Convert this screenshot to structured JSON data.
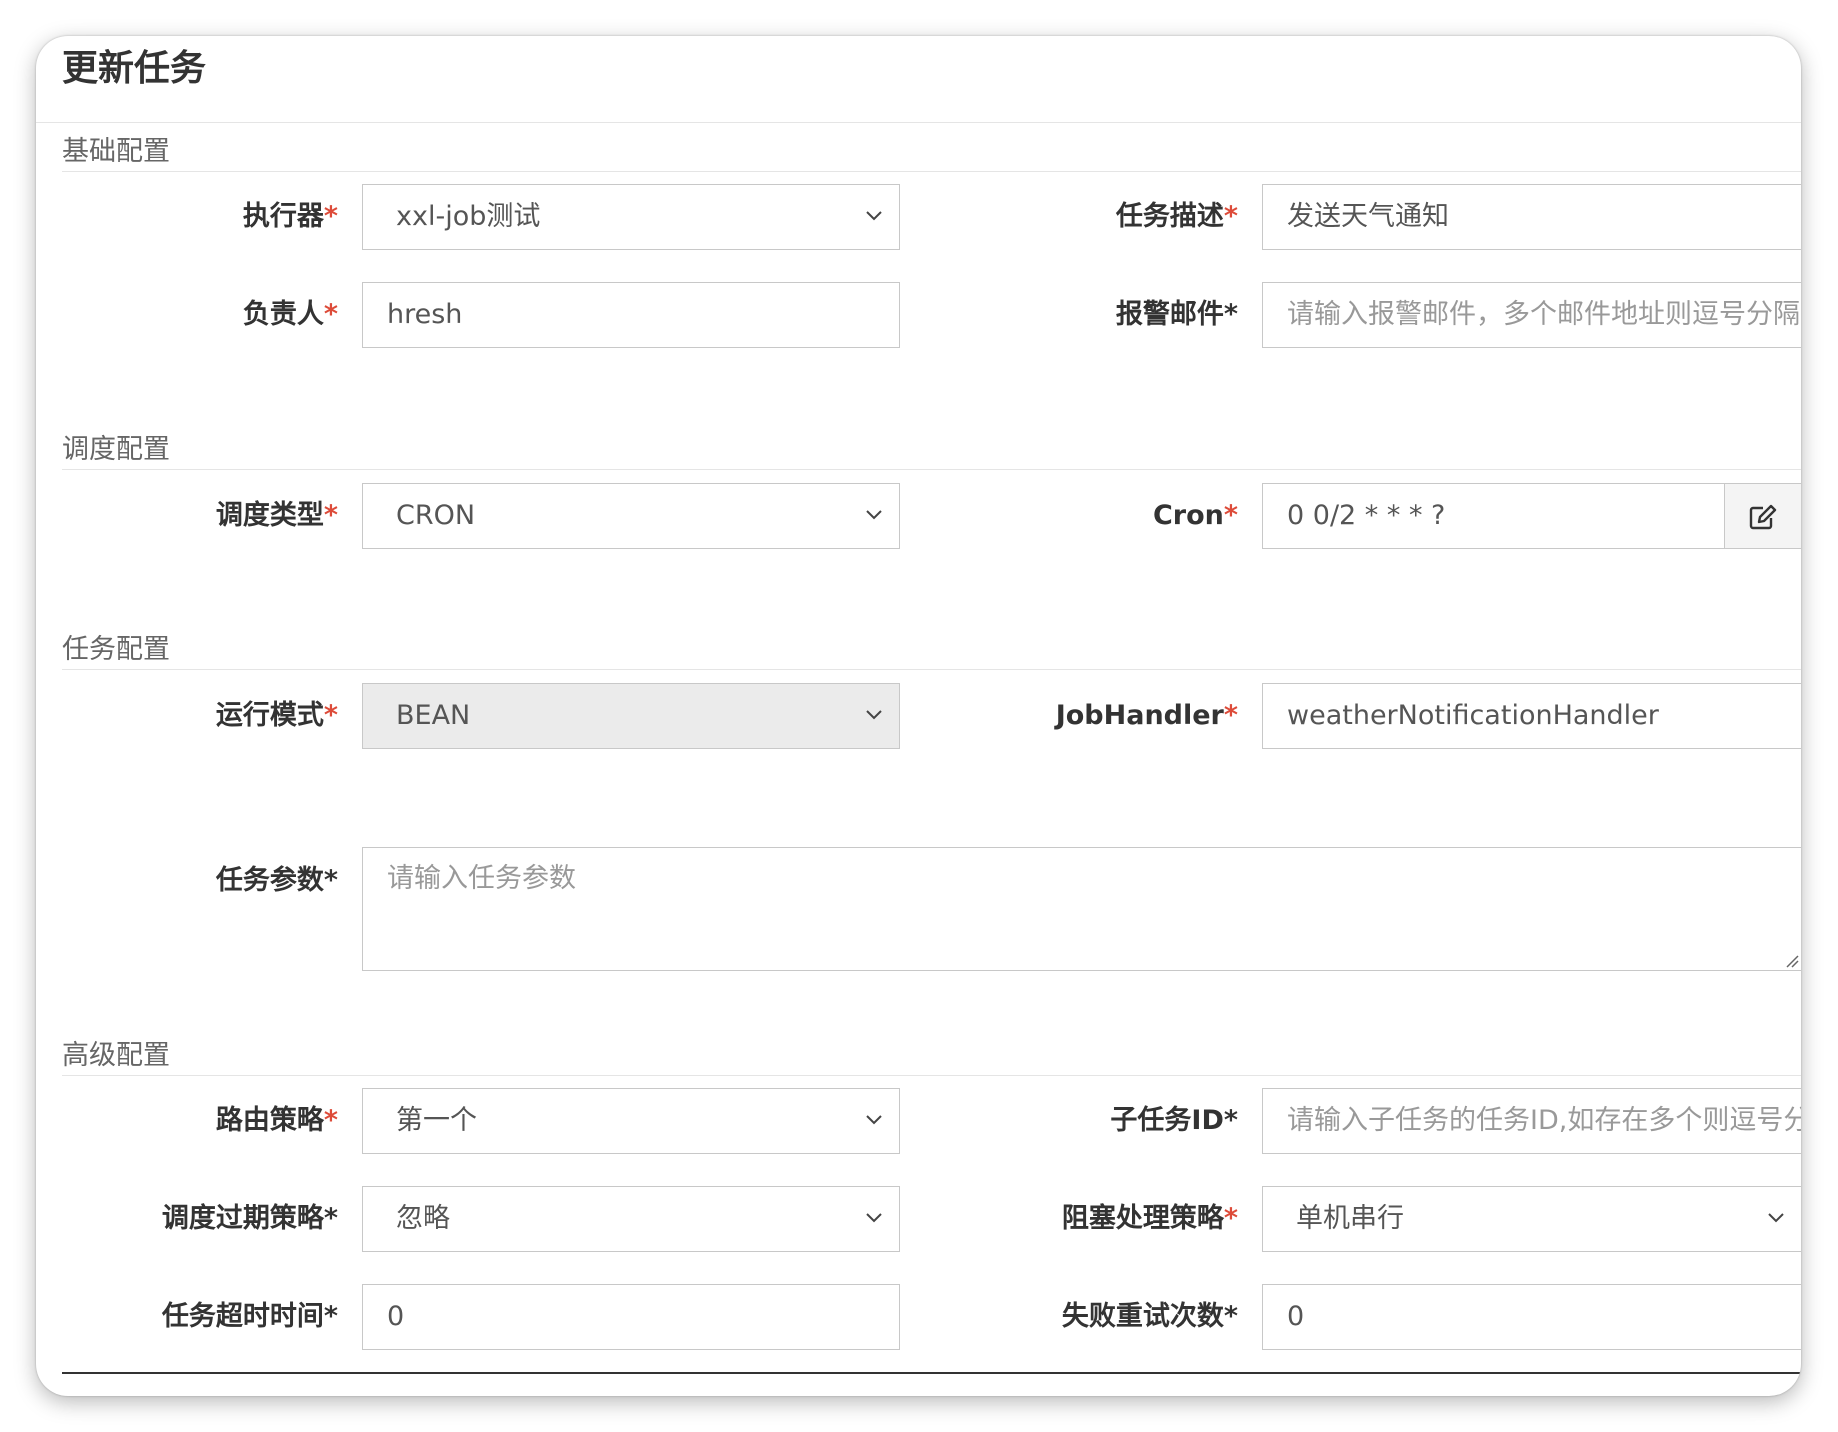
{
  "modal": {
    "title": "更新任务"
  },
  "sections": {
    "basic": "基础配置",
    "schedule": "调度配置",
    "task": "任务配置",
    "advanced": "高级配置"
  },
  "required_mark": "*",
  "fields": {
    "executor": {
      "label": "执行器",
      "value": "xxl-job测试"
    },
    "job_desc": {
      "label": "任务描述",
      "value": "发送天气通知"
    },
    "author": {
      "label": "负责人",
      "value": "hresh"
    },
    "alarm_email": {
      "label": "报警邮件",
      "placeholder": "请输入报警邮件，多个邮件地址则逗号分隔"
    },
    "schedule_type": {
      "label": "调度类型",
      "value": "CRON"
    },
    "cron": {
      "label": "Cron",
      "value": "0 0/2 * * * ?"
    },
    "glue_type": {
      "label": "运行模式",
      "value": "BEAN"
    },
    "job_handler": {
      "label": "JobHandler",
      "value": "weatherNotificationHandler"
    },
    "job_param": {
      "label": "任务参数",
      "placeholder": "请输入任务参数"
    },
    "route_strategy": {
      "label": "路由策略",
      "value": "第一个"
    },
    "child_job_id": {
      "label": "子任务ID",
      "placeholder": "请输入子任务的任务ID,如存在多个则逗号分隔"
    },
    "misfire_strategy": {
      "label": "调度过期策略",
      "value": "忽略"
    },
    "block_strategy": {
      "label": "阻塞处理策略",
      "value": "单机串行"
    },
    "timeout": {
      "label": "任务超时时间",
      "value": "0"
    },
    "fail_retry": {
      "label": "失败重试次数",
      "value": "0"
    }
  },
  "colors": {
    "required": "#dd4b39",
    "border": "#c8c8c8",
    "disabled_bg": "#ebebeb"
  },
  "icons": {
    "select_arrow": "chevron-down-icon",
    "cron_edit": "edit-icon"
  }
}
